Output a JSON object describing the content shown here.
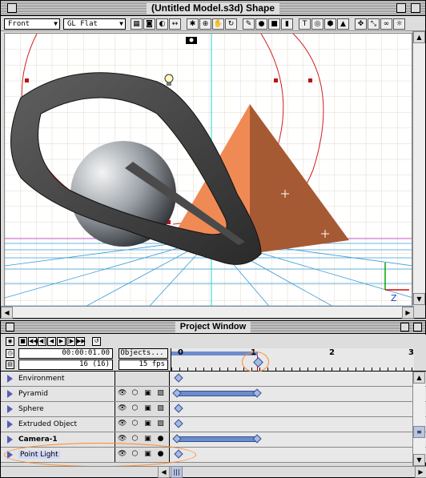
{
  "shape_window": {
    "title": "(Untitled Model.s3d) Shape",
    "view_select": "Front",
    "render_select": "GL Flat",
    "toolbar_icons": [
      "grid-icon",
      "camera-icon",
      "light-icon",
      "axis-icon",
      "gear-icon",
      "zoom-icon",
      "hand-icon",
      "rotate-icon",
      "pen-icon",
      "sphere-icon",
      "cube-icon",
      "cylinder-icon"
    ],
    "axis_label": "Z"
  },
  "project_window": {
    "title": "Project Window",
    "time": "00:00:01.00",
    "frame": "16 (16)",
    "objects_button": "Objects...",
    "fps": "15 fps",
    "ruler": {
      "t0": "0",
      "t1": "1",
      "t2": "2",
      "t3": "3"
    },
    "rows": [
      {
        "name": "Environment",
        "bold": false,
        "highlight": false
      },
      {
        "name": "Pyramid",
        "bold": false,
        "highlight": false
      },
      {
        "name": "Sphere",
        "bold": false,
        "highlight": false
      },
      {
        "name": "Extruded Object",
        "bold": false,
        "highlight": false
      },
      {
        "name": "Camera-1",
        "bold": true,
        "highlight": false
      },
      {
        "name": "Point Light",
        "bold": false,
        "highlight": true
      }
    ]
  },
  "colors": {
    "keyframe": "#6d8ccf",
    "highlight": "#ff8a2a",
    "pyramid": "#f08a55"
  }
}
